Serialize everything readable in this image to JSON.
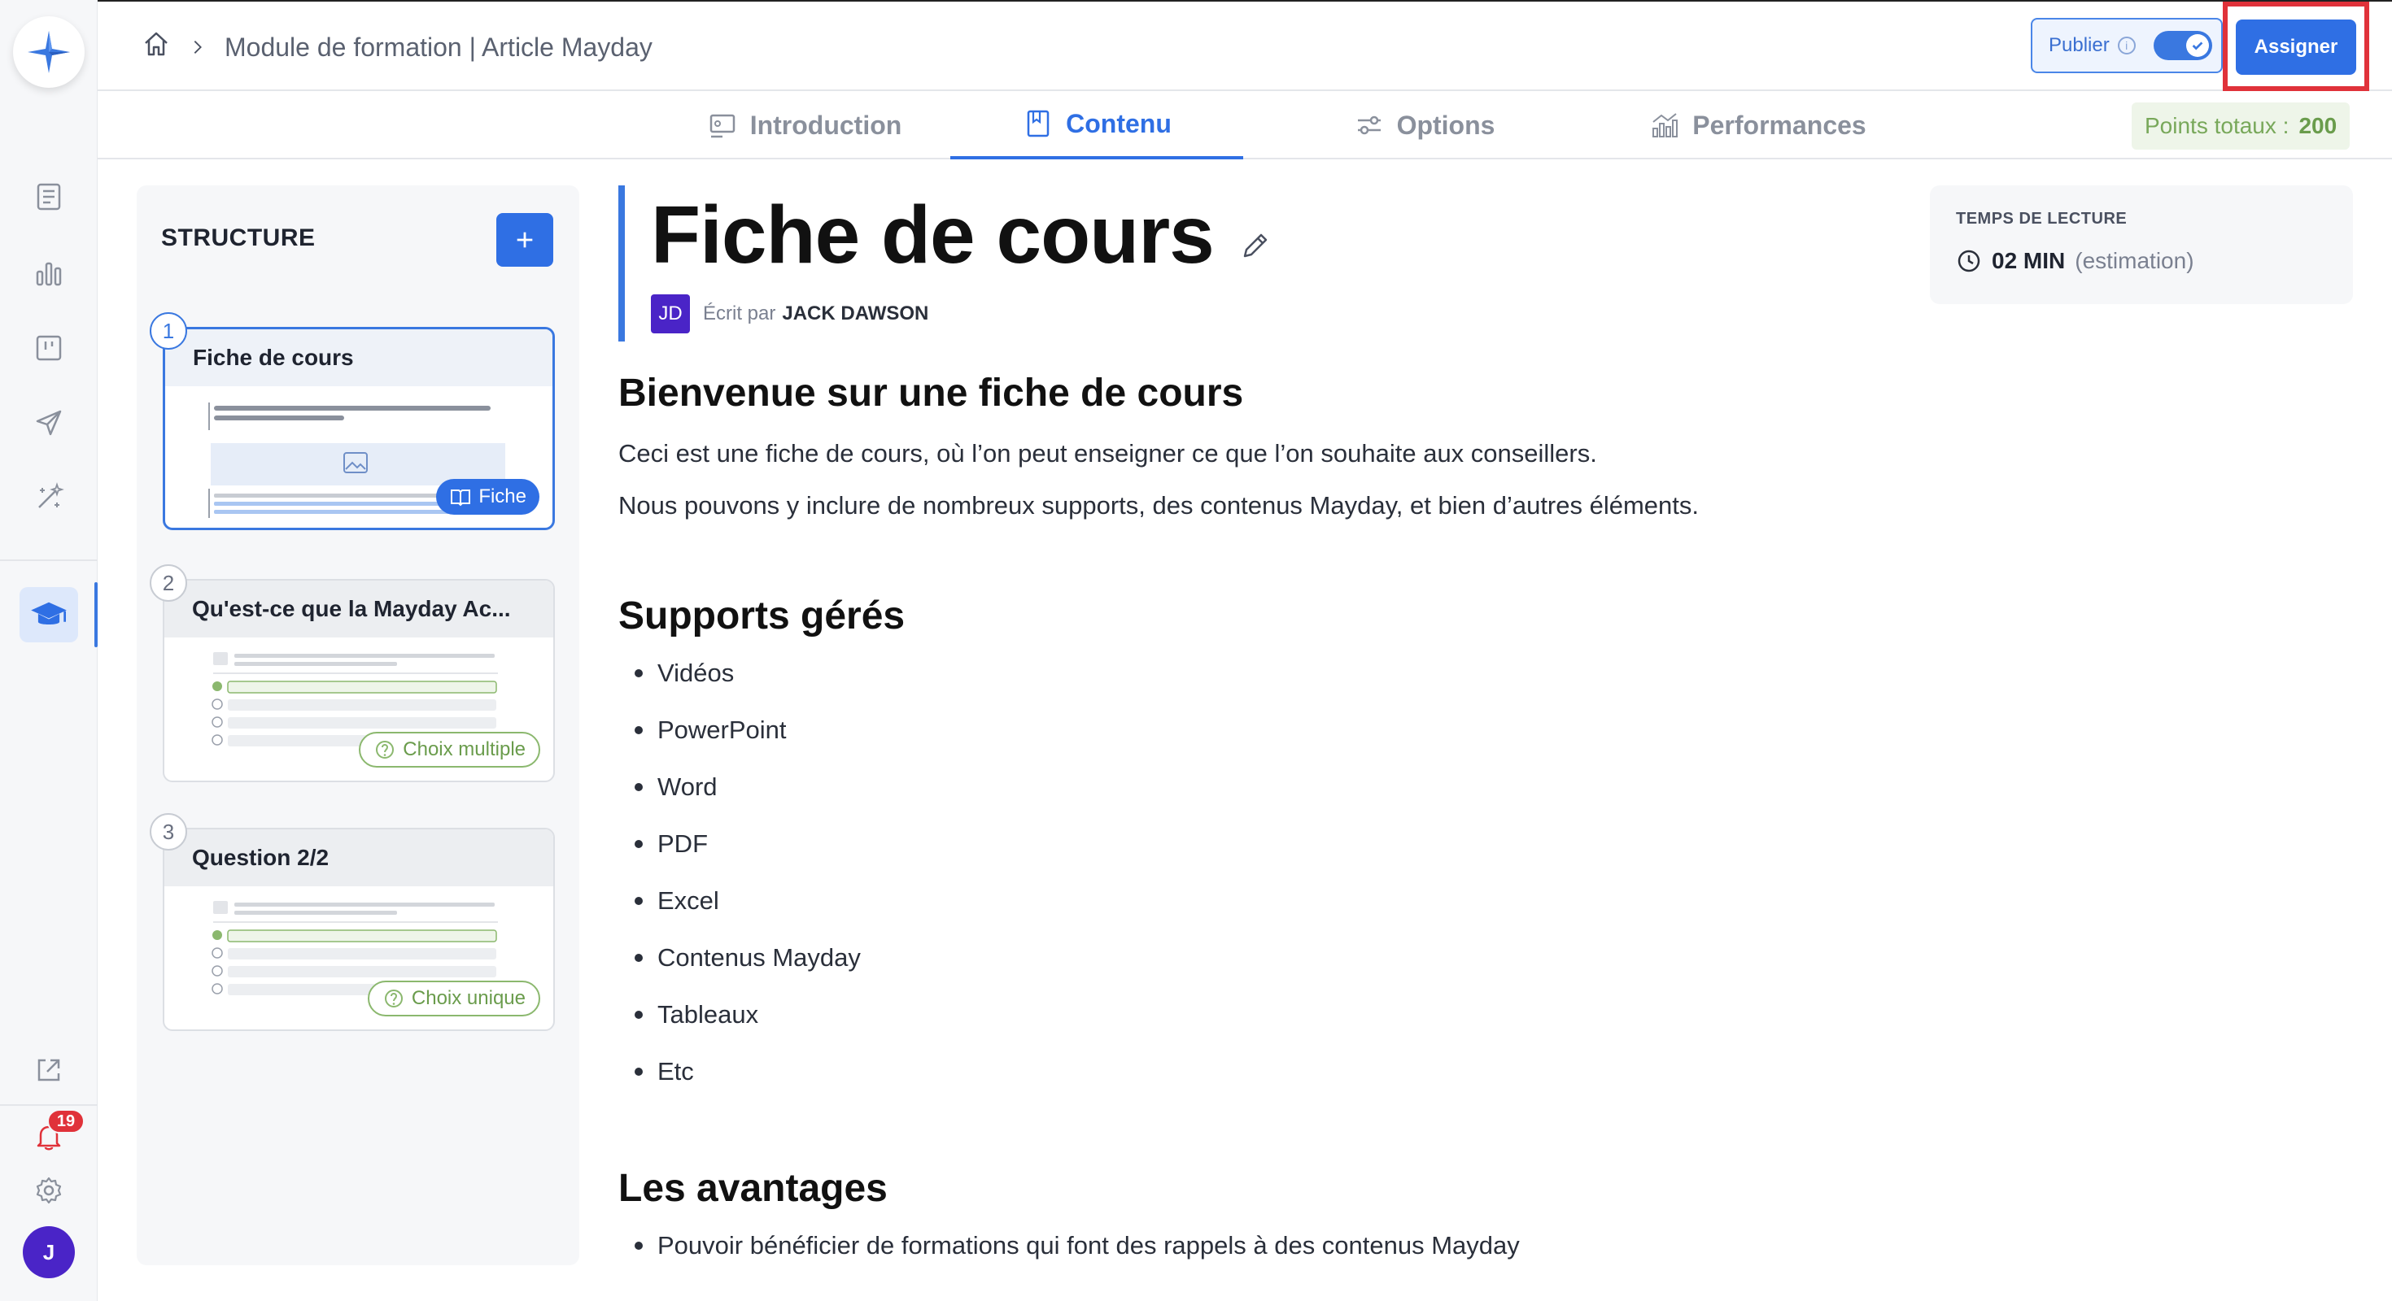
{
  "app": {
    "notification_count": "19",
    "user_initial": "J",
    "accent_color": "#2f6fe4"
  },
  "breadcrumb": {
    "path": "Module de formation | Article Mayday"
  },
  "header": {
    "publish_label": "Publier",
    "publish_enabled": true,
    "assign_label": "Assigner"
  },
  "tabs": [
    {
      "label": "Introduction",
      "icon": "introduction-icon",
      "active": false
    },
    {
      "label": "Contenu",
      "icon": "book-icon",
      "active": true
    },
    {
      "label": "Options",
      "icon": "sliders-icon",
      "active": false
    },
    {
      "label": "Performances",
      "icon": "performance-chart-icon",
      "active": false
    }
  ],
  "points": {
    "label": "Points totaux :",
    "value": "200"
  },
  "structure": {
    "title": "STRUCTURE",
    "steps": [
      {
        "number": "1",
        "title": "Fiche de cours",
        "type_label": "Fiche",
        "active": true
      },
      {
        "number": "2",
        "title": "Qu'est-ce que la Mayday Ac...",
        "type_label": "Choix multiple",
        "active": false
      },
      {
        "number": "3",
        "title": "Question 2/2",
        "type_label": "Choix unique",
        "active": false
      }
    ]
  },
  "article": {
    "title": "Fiche de cours",
    "author_initials": "JD",
    "author_prefix": "Écrit par",
    "author_name": "JACK DAWSON",
    "reading_time_label": "TEMPS DE LECTURE",
    "reading_time_value": "02 MIN",
    "reading_time_note": "(estimation)",
    "heading_1": "Bienvenue sur une fiche de cours",
    "para_1": "Ceci est une fiche de cours, où l’on peut enseigner ce que l’on souhaite aux conseillers.",
    "para_2": "Nous pouvons y inclure de nombreux supports, des contenus Mayday, et bien d’autres éléments.",
    "heading_2": "Supports gérés",
    "supports": [
      "Vidéos",
      "PowerPoint",
      "Word",
      "PDF",
      "Excel",
      "Contenus Mayday",
      "Tableaux",
      "Etc"
    ],
    "heading_3": "Les avantages",
    "advantages": [
      "Pouvoir bénéficier de formations qui font des rappels à des contenus Mayday"
    ]
  }
}
